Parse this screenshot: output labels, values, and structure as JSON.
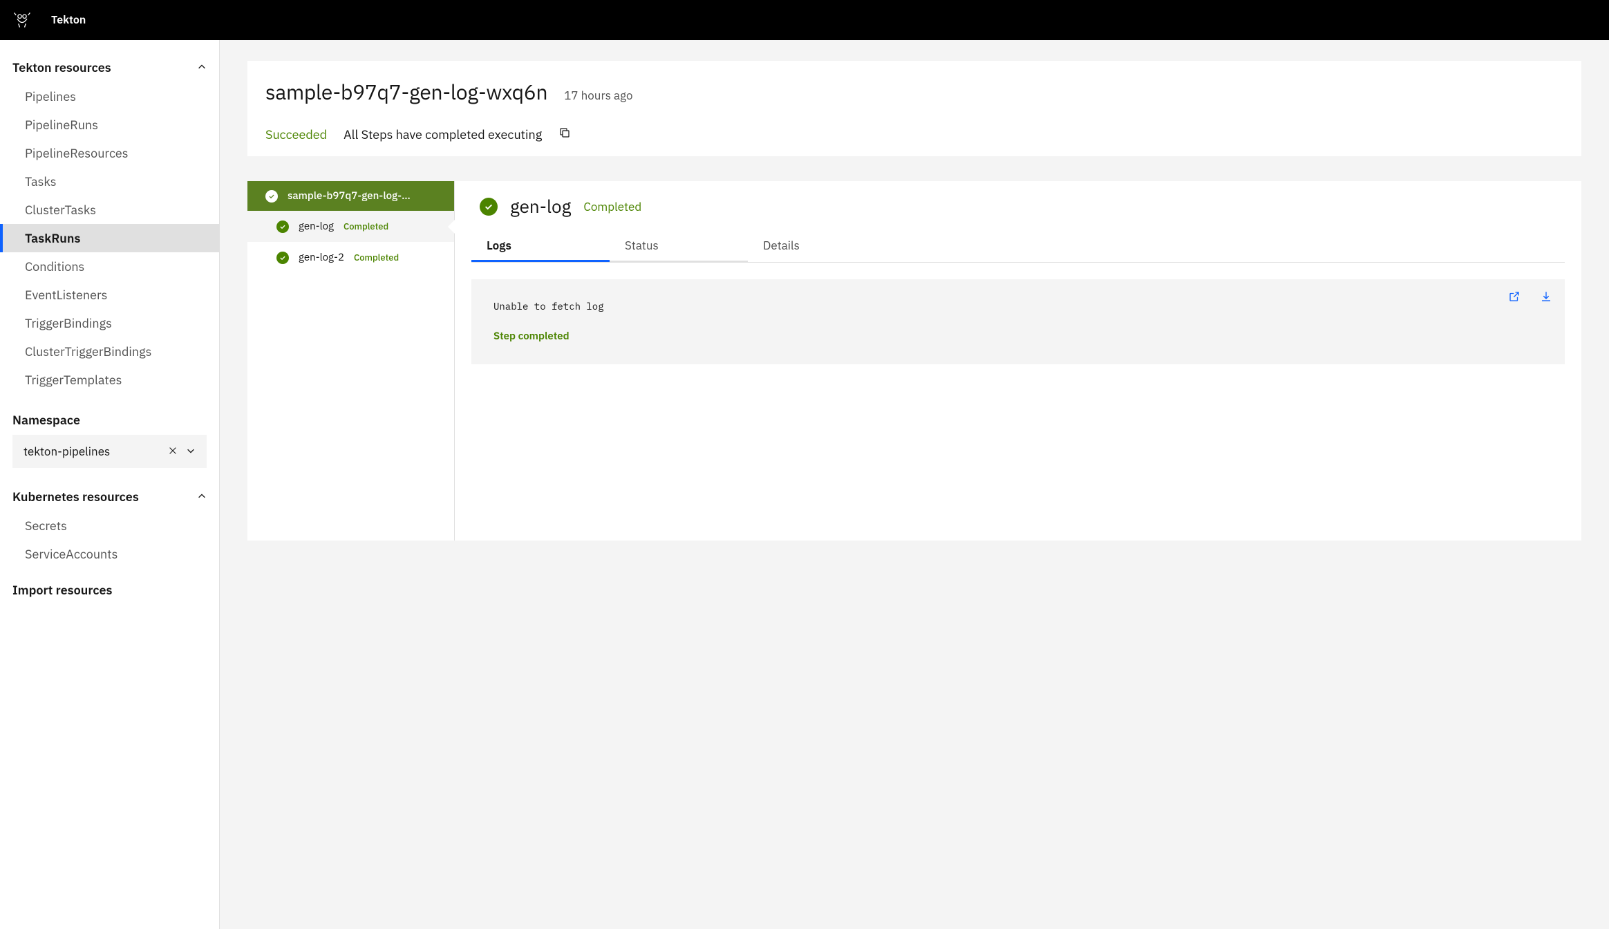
{
  "header": {
    "brand": "Tekton"
  },
  "sidebar": {
    "sections": {
      "tekton": {
        "title": "Tekton resources",
        "items": [
          "Pipelines",
          "PipelineRuns",
          "PipelineResources",
          "Tasks",
          "ClusterTasks",
          "TaskRuns",
          "Conditions",
          "EventListeners",
          "TriggerBindings",
          "ClusterTriggerBindings",
          "TriggerTemplates"
        ]
      },
      "namespace": {
        "label": "Namespace",
        "value": "tekton-pipelines"
      },
      "k8s": {
        "title": "Kubernetes resources",
        "items": [
          "Secrets",
          "ServiceAccounts"
        ]
      },
      "import": {
        "title": "Import resources"
      }
    }
  },
  "main": {
    "title": "sample-b97q7-gen-log-wxq6n",
    "timestamp": "17 hours ago",
    "status": "Succeeded",
    "status_detail": "All Steps have completed executing",
    "task_header": "sample-b97q7-gen-log-…",
    "steps": [
      {
        "name": "gen-log",
        "status": "Completed",
        "selected": true
      },
      {
        "name": "gen-log-2",
        "status": "Completed",
        "selected": false
      }
    ],
    "detail": {
      "title": "gen-log",
      "status": "Completed",
      "tabs": [
        "Logs",
        "Status",
        "Details"
      ],
      "active_tab": "Logs",
      "log_text": "Unable to fetch log",
      "log_footer": "Step completed"
    }
  }
}
